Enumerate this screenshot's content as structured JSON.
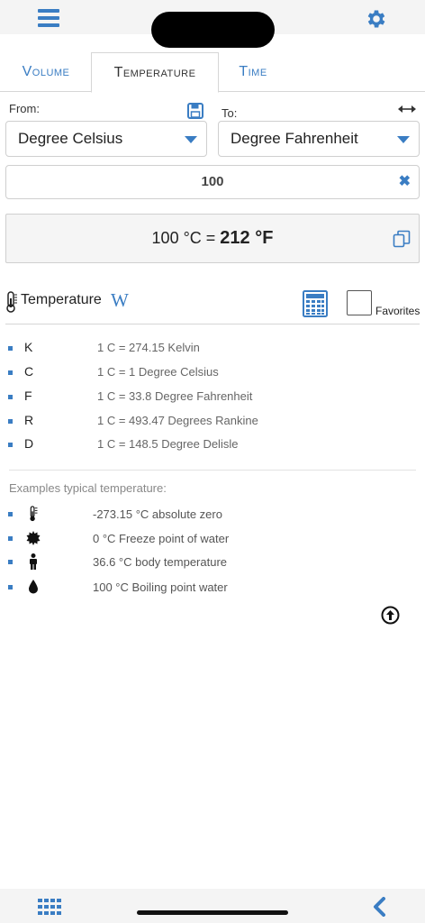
{
  "header": {
    "menu_icon": "hamburger-menu-icon",
    "settings_icon": "gear-icon",
    "accent_color": "#3a7dc3"
  },
  "tabs": [
    {
      "label": "Volume",
      "active": false
    },
    {
      "label": "Temperature",
      "active": true
    },
    {
      "label": "Time",
      "active": false
    }
  ],
  "converter": {
    "from_label": "From:",
    "to_label": "To:",
    "from_unit": "Degree Celsius",
    "to_unit": "Degree Fahrenheit",
    "input_value": "100",
    "result_prefix": "100 °C = ",
    "result_value": "212 °F"
  },
  "section": {
    "title": "Temperature",
    "wiki_label": "W",
    "favorites_label": "Favorites",
    "favorites_checked": false
  },
  "units": [
    {
      "symbol": "K",
      "desc": "1 C = 274.15 Kelvin"
    },
    {
      "symbol": "C",
      "desc": "1 C = 1 Degree Celsius"
    },
    {
      "symbol": "F",
      "desc": "1 C = 33.8 Degree Fahrenheit"
    },
    {
      "symbol": "R",
      "desc": "1 C = 493.47 Degrees Rankine"
    },
    {
      "symbol": "D",
      "desc": "1 C = 148.5 Degree Delisle"
    }
  ],
  "examples": {
    "title": "Examples typical temperature:",
    "items": [
      {
        "icon": "thermometer-icon",
        "text": "-273.15 °C absolute zero"
      },
      {
        "icon": "snowflake-icon",
        "text": "0 °C Freeze point of water"
      },
      {
        "icon": "person-icon",
        "text": "36.6 °C body temperature"
      },
      {
        "icon": "water-drop-icon",
        "text": "100 °C Boiling point water"
      }
    ]
  }
}
